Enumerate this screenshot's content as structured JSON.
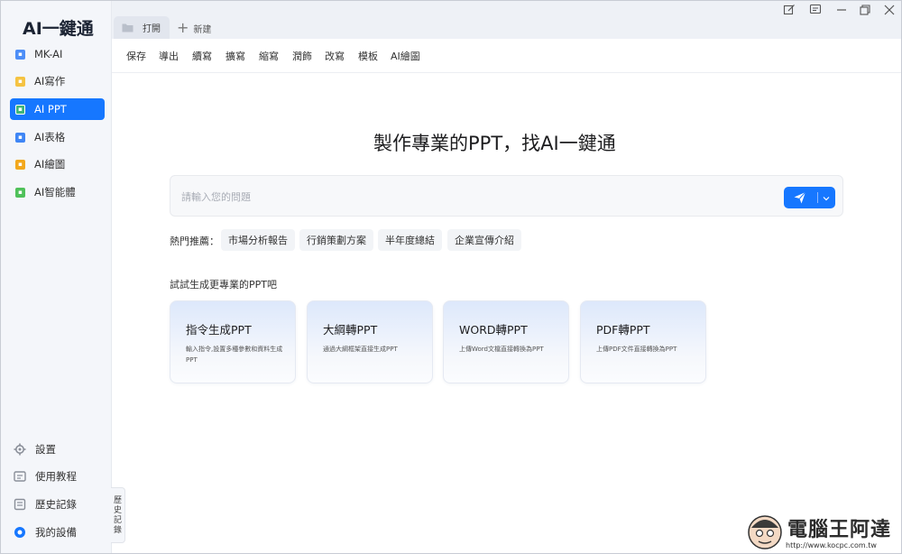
{
  "app": {
    "logo": "AI一鍵通"
  },
  "sidebar": {
    "items": [
      {
        "label": "MK-AI",
        "icon": "mk-ai-icon",
        "color": "#4d8ef7"
      },
      {
        "label": "AI寫作",
        "icon": "ai-write-icon",
        "color": "#f5c342"
      },
      {
        "label": "AI PPT",
        "icon": "ai-ppt-icon",
        "color": "#3fb67a",
        "active": true
      },
      {
        "label": "AI表格",
        "icon": "ai-table-icon",
        "color": "#3f86f5"
      },
      {
        "label": "AI繪圖",
        "icon": "ai-draw-icon",
        "color": "#f2a81d"
      },
      {
        "label": "AI智能體",
        "icon": "ai-agent-icon",
        "color": "#4fc15a"
      }
    ],
    "bottom": [
      {
        "label": "設置",
        "icon": "gear-icon"
      },
      {
        "label": "使用教程",
        "icon": "tutorial-icon"
      },
      {
        "label": "歷史記錄",
        "icon": "history-icon"
      },
      {
        "label": "我的設備",
        "icon": "device-icon"
      }
    ],
    "history_tab": "歷\n史\n記\n錄"
  },
  "tabs": {
    "open_tab": "打開",
    "new_tab": "新建"
  },
  "toolbar": {
    "items": [
      "保存",
      "導出",
      "續寫",
      "擴寫",
      "縮寫",
      "潤飾",
      "改寫",
      "模板",
      "AI繪圖"
    ]
  },
  "main": {
    "headline": "製作專業的PPT，找AI一鍵通",
    "search_placeholder": "請輸入您的問題",
    "hot_label": "熱門推薦：",
    "hot_chips": [
      "市場分析報告",
      "行銷策劃方案",
      "半年度總結",
      "企業宣傳介紹"
    ],
    "try_title": "試試生成更專業的PPT吧",
    "cards": [
      {
        "title": "指令生成PPT",
        "desc": "輸入指令,設置多種參數和資料生成PPT"
      },
      {
        "title": "大綱轉PPT",
        "desc": "通過大綱框架直接生成PPT"
      },
      {
        "title": "WORD轉PPT",
        "desc": "上傳Word文檔直接轉換為PPT"
      },
      {
        "title": "PDF轉PPT",
        "desc": "上傳PDF文件直接轉換為PPT"
      }
    ]
  },
  "watermark": {
    "name": "電腦王阿達",
    "url": "http://www.kocpc.com.tw"
  },
  "colors": {
    "accent": "#1677ff",
    "sidebar_bg": "#f4f6fa"
  }
}
